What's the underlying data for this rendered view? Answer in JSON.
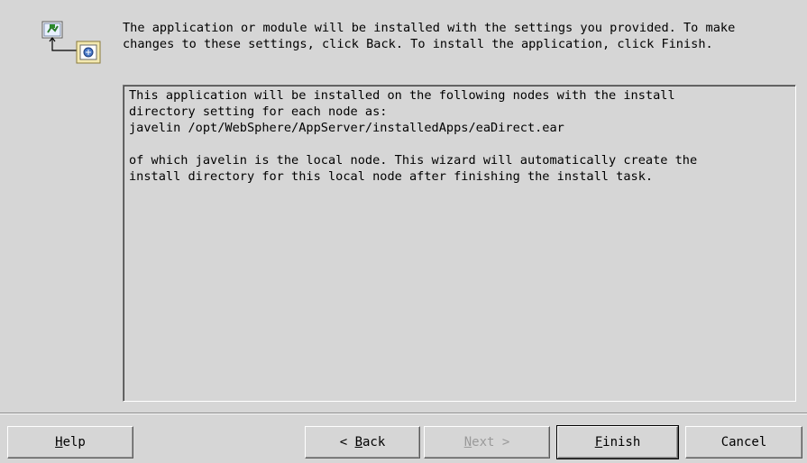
{
  "intro": {
    "line1": "The application or module will be installed with the settings you provided. To make",
    "line2": "changes to these settings, click Back. To install the application, click Finish."
  },
  "details": {
    "lines_a": [
      "This application will be installed on the following nodes with the install",
      "directory setting for each node as:",
      "javelin /opt/WebSphere/AppServer/installedApps/eaDirect.ear"
    ],
    "lines_b": [
      "of which javelin is the local node. This wizard will automatically create the",
      "install directory for this local node after finishing the install task."
    ]
  },
  "buttons": {
    "help": {
      "mnemonic": "H",
      "rest": "elp"
    },
    "back": {
      "prefix": "< ",
      "mnemonic": "B",
      "rest": "ack"
    },
    "next": {
      "mnemonic": "N",
      "rest": "ext >"
    },
    "finish": {
      "mnemonic": "F",
      "rest": "inish"
    },
    "cancel": {
      "label": "Cancel"
    }
  },
  "icons": {
    "wizard": "install-wizard-icon"
  }
}
